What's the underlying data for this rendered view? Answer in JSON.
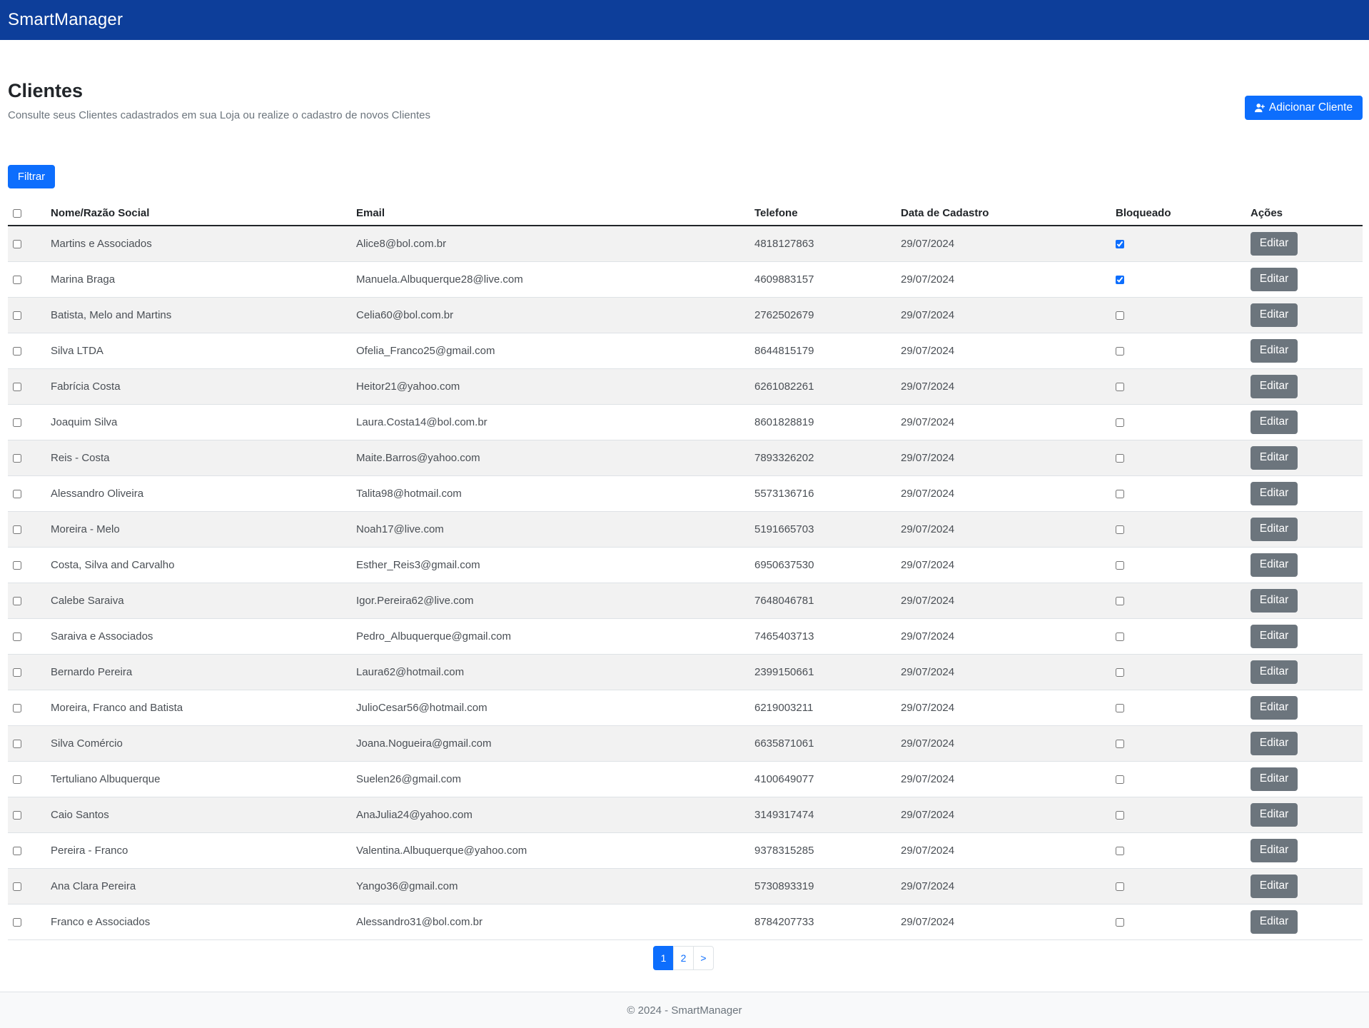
{
  "app": {
    "brand": "SmartManager"
  },
  "header": {
    "title": "Clientes",
    "subtitle": "Consulte seus Clientes cadastrados em sua Loja ou realize o cadastro de novos Clientes",
    "add_button_label": "Adicionar Cliente",
    "add_button_icon": "user-plus-icon"
  },
  "filter": {
    "label": "Filtrar"
  },
  "table": {
    "columns": [
      "Nome/Razão Social",
      "Email",
      "Telefone",
      "Data de Cadastro",
      "Bloqueado",
      "Ações"
    ],
    "edit_label": "Editar",
    "rows": [
      {
        "name": "Martins e Associados",
        "email": "Alice8@bol.com.br",
        "phone": "4818127863",
        "date": "29/07/2024",
        "blocked": true
      },
      {
        "name": "Marina Braga",
        "email": "Manuela.Albuquerque28@live.com",
        "phone": "4609883157",
        "date": "29/07/2024",
        "blocked": true
      },
      {
        "name": "Batista, Melo and Martins",
        "email": "Celia60@bol.com.br",
        "phone": "2762502679",
        "date": "29/07/2024",
        "blocked": false
      },
      {
        "name": "Silva LTDA",
        "email": "Ofelia_Franco25@gmail.com",
        "phone": "8644815179",
        "date": "29/07/2024",
        "blocked": false
      },
      {
        "name": "Fabrícia Costa",
        "email": "Heitor21@yahoo.com",
        "phone": "6261082261",
        "date": "29/07/2024",
        "blocked": false
      },
      {
        "name": "Joaquim Silva",
        "email": "Laura.Costa14@bol.com.br",
        "phone": "8601828819",
        "date": "29/07/2024",
        "blocked": false
      },
      {
        "name": "Reis - Costa",
        "email": "Maite.Barros@yahoo.com",
        "phone": "7893326202",
        "date": "29/07/2024",
        "blocked": false
      },
      {
        "name": "Alessandro Oliveira",
        "email": "Talita98@hotmail.com",
        "phone": "5573136716",
        "date": "29/07/2024",
        "blocked": false
      },
      {
        "name": "Moreira - Melo",
        "email": "Noah17@live.com",
        "phone": "5191665703",
        "date": "29/07/2024",
        "blocked": false
      },
      {
        "name": "Costa, Silva and Carvalho",
        "email": "Esther_Reis3@gmail.com",
        "phone": "6950637530",
        "date": "29/07/2024",
        "blocked": false
      },
      {
        "name": "Calebe Saraiva",
        "email": "Igor.Pereira62@live.com",
        "phone": "7648046781",
        "date": "29/07/2024",
        "blocked": false
      },
      {
        "name": "Saraiva e Associados",
        "email": "Pedro_Albuquerque@gmail.com",
        "phone": "7465403713",
        "date": "29/07/2024",
        "blocked": false
      },
      {
        "name": "Bernardo Pereira",
        "email": "Laura62@hotmail.com",
        "phone": "2399150661",
        "date": "29/07/2024",
        "blocked": false
      },
      {
        "name": "Moreira, Franco and Batista",
        "email": "JulioCesar56@hotmail.com",
        "phone": "6219003211",
        "date": "29/07/2024",
        "blocked": false
      },
      {
        "name": "Silva Comércio",
        "email": "Joana.Nogueira@gmail.com",
        "phone": "6635871061",
        "date": "29/07/2024",
        "blocked": false
      },
      {
        "name": "Tertuliano Albuquerque",
        "email": "Suelen26@gmail.com",
        "phone": "4100649077",
        "date": "29/07/2024",
        "blocked": false
      },
      {
        "name": "Caio Santos",
        "email": "AnaJulia24@yahoo.com",
        "phone": "3149317474",
        "date": "29/07/2024",
        "blocked": false
      },
      {
        "name": "Pereira - Franco",
        "email": "Valentina.Albuquerque@yahoo.com",
        "phone": "9378315285",
        "date": "29/07/2024",
        "blocked": false
      },
      {
        "name": "Ana Clara Pereira",
        "email": "Yango36@gmail.com",
        "phone": "5730893319",
        "date": "29/07/2024",
        "blocked": false
      },
      {
        "name": "Franco e Associados",
        "email": "Alessandro31@bol.com.br",
        "phone": "8784207733",
        "date": "29/07/2024",
        "blocked": false
      }
    ]
  },
  "pagination": {
    "pages": [
      "1",
      "2"
    ],
    "current": "1",
    "next_label": ">"
  },
  "footer": {
    "text": "© 2024 - SmartManager"
  },
  "colors": {
    "navbar": "#0d3e9a",
    "primary": "#0d6efd",
    "secondary": "#6c757d"
  }
}
